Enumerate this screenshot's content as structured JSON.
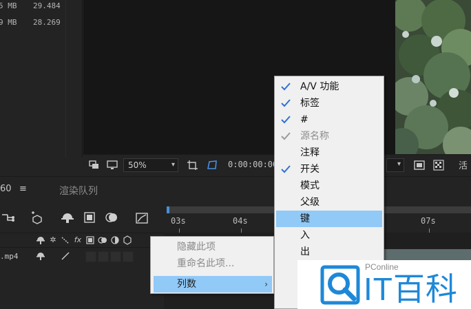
{
  "project_panel": {
    "rows": [
      {
        "size": "5 MB",
        "duration": "29.484"
      },
      {
        "size": "9 MB",
        "duration": "28.269"
      }
    ]
  },
  "viewer_bar": {
    "zoom": "50%",
    "timecode": "0:00:00:00",
    "active_camera": "活"
  },
  "timeline": {
    "comp_tab_label": "60",
    "menu_glyph": "≡",
    "render_queue_label": "渲染队列",
    "ruler_ticks": [
      "03s",
      "04s",
      "07s"
    ],
    "layer_name": ".mp4"
  },
  "context_menu": {
    "items": [
      {
        "label": "隐藏此项",
        "enabled": false
      },
      {
        "label": "重命名此项...",
        "enabled": false
      },
      {
        "label": "列数",
        "enabled": true,
        "highlighted": true,
        "submenu_arrow": "›"
      }
    ]
  },
  "columns_submenu": {
    "items": [
      {
        "label": "A/V 功能",
        "checked": true,
        "enabled": true
      },
      {
        "label": "标签",
        "checked": true,
        "enabled": true
      },
      {
        "label": "#",
        "checked": true,
        "enabled": true
      },
      {
        "label": "源名称",
        "checked": true,
        "enabled": false
      },
      {
        "label": "注释",
        "checked": false,
        "enabled": true
      },
      {
        "label": "开关",
        "checked": true,
        "enabled": true
      },
      {
        "label": "模式",
        "checked": false,
        "enabled": true
      },
      {
        "label": "父级",
        "checked": false,
        "enabled": true
      },
      {
        "label": "键",
        "checked": false,
        "enabled": true,
        "highlighted": true
      },
      {
        "label": "入",
        "checked": false,
        "enabled": true
      },
      {
        "label": "出",
        "checked": false,
        "enabled": true
      }
    ]
  },
  "watermark": {
    "brand": "PConline",
    "title": "IT百科"
  },
  "colors": {
    "panel_bg": "#232323",
    "menu_bg": "#f0f0f0",
    "menu_highlight": "#91c9f7",
    "check_blue": "#2f6fd8",
    "brand_blue": "#1e88d8"
  }
}
